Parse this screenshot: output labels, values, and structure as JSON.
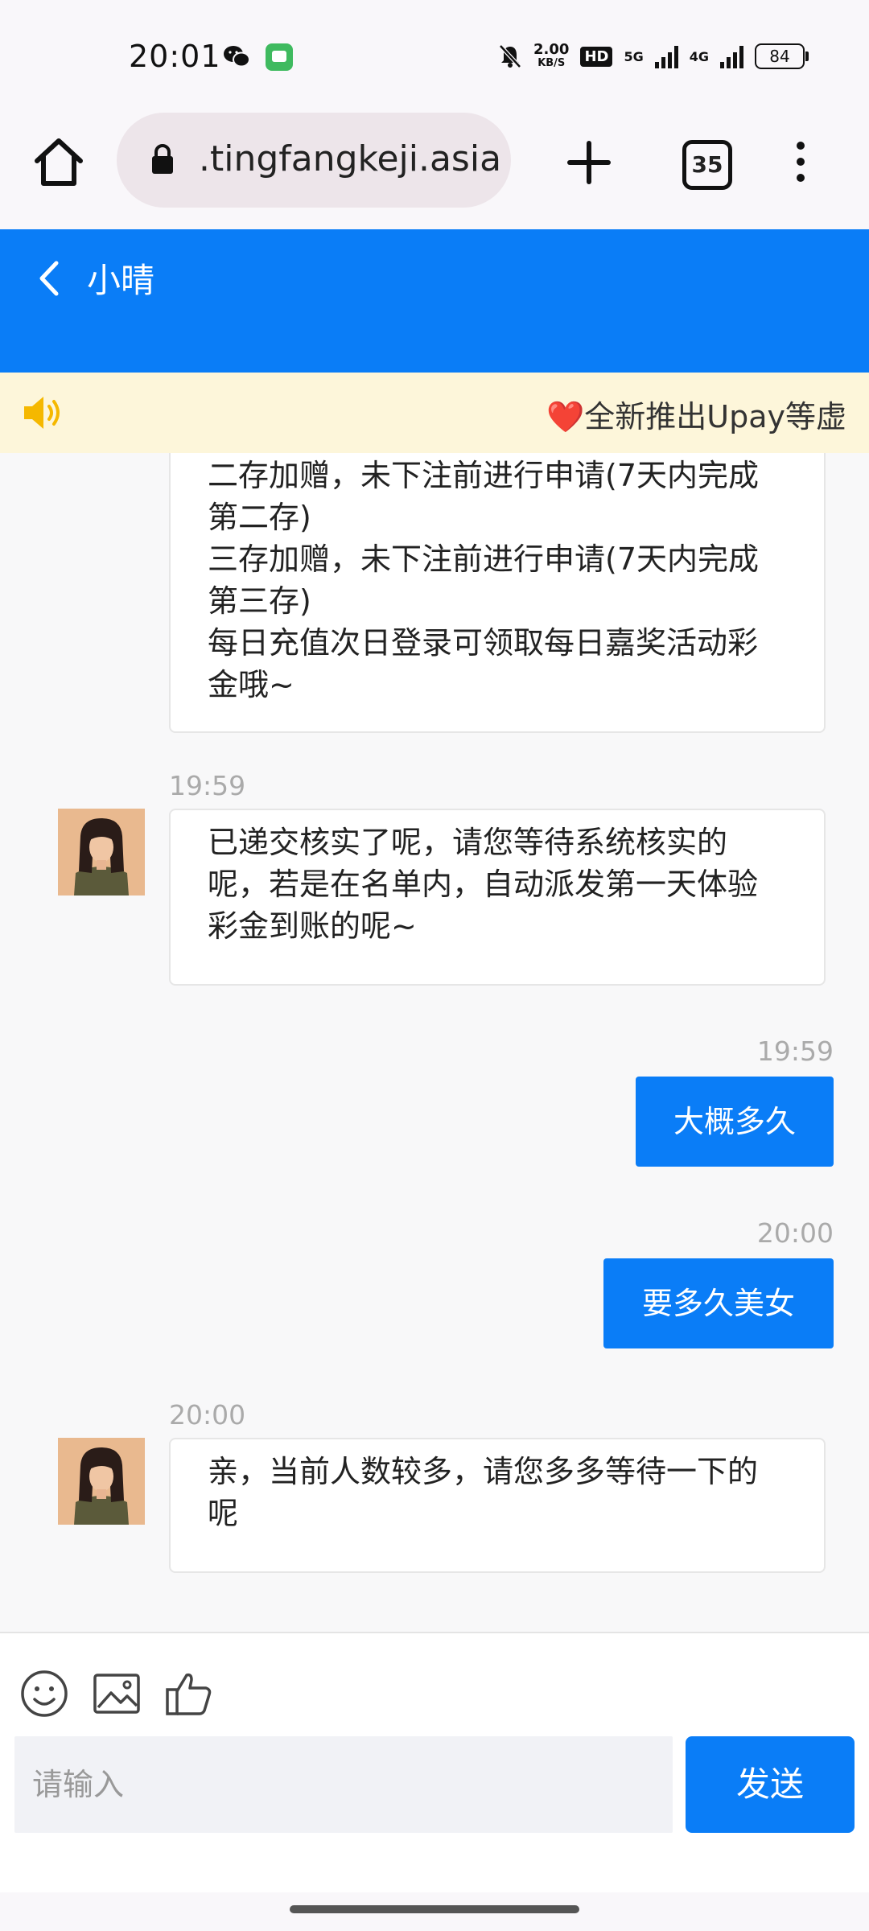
{
  "status_bar": {
    "time": "20:01",
    "speed_value": "2.00",
    "speed_unit": "KB/S",
    "hd": "HD",
    "net1": "5G",
    "net2": "4G",
    "battery": "84"
  },
  "browser": {
    "url": ".tingfangkeji.asia",
    "tab_count": "35"
  },
  "chat_header": {
    "title": "小晴"
  },
  "notice": {
    "text": "❤️全新推出Upay等虚"
  },
  "messages": [
    {
      "side": "left",
      "text": "二存加赠，未下注前进行申请(7天内完成\n第二存)\n三存加赠，未下注前进行申请(7天内完成\n第三存)\n每日充值次日登录可领取每日嘉奖活动彩\n金哦~"
    },
    {
      "side": "left",
      "time": "19:59",
      "text": "已递交核实了呢，请您等待系统核实的\n呢，若是在名单内，自动派发第一天体验\n彩金到账的呢~"
    },
    {
      "side": "right",
      "time": "19:59",
      "text": "大概多久"
    },
    {
      "side": "right",
      "time": "20:00",
      "text": "要多久美女"
    },
    {
      "side": "left",
      "time": "20:00",
      "text": "亲，当前人数较多，请您多多等待一下的\n呢"
    }
  ],
  "input": {
    "placeholder": "请输入",
    "send_label": "发送"
  },
  "colors": {
    "accent": "#0a7df7",
    "notice_bg": "#fdf6da"
  },
  "icons": [
    "home-icon",
    "lock-icon",
    "plus-icon",
    "more-icon",
    "back-icon",
    "speaker-icon",
    "emoji-icon",
    "image-icon",
    "thumbs-up-icon"
  ]
}
